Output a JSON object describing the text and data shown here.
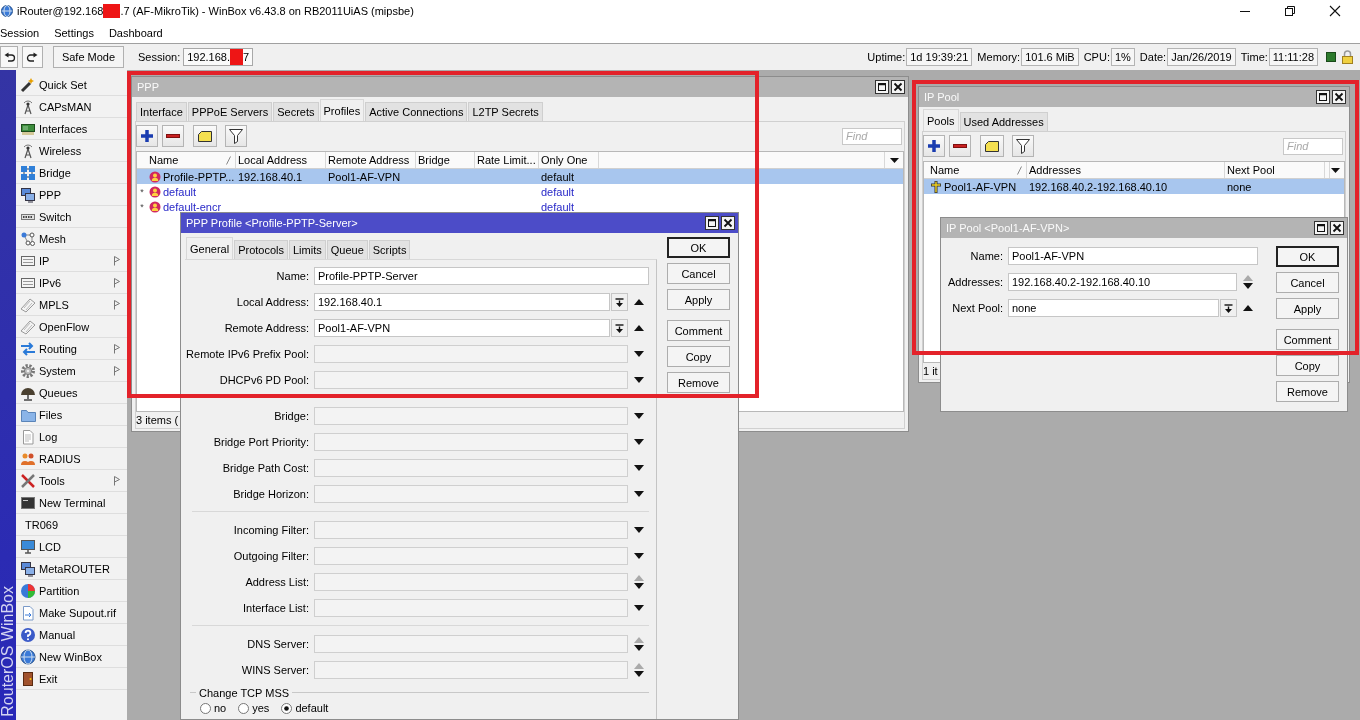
{
  "window": {
    "title": [
      {
        "kind": "text",
        "text": "iRouter@192.168"
      },
      {
        "kind": "redaction"
      },
      {
        "kind": "text",
        "text": ".7 (AF-MikroTik) - WinBox v6.43.8 on RB2011UiAS (mipsbe)"
      }
    ]
  },
  "menu": [
    {
      "label": "Session"
    },
    {
      "label": "Settings"
    },
    {
      "label": "Dashboard"
    }
  ],
  "toolbar": {
    "safe_mode": "Safe Mode",
    "session_label": "Session:",
    "session_value": [
      {
        "kind": "text",
        "text": "192.168."
      },
      {
        "kind": "redaction"
      },
      {
        "kind": "text",
        "text": "7"
      }
    ],
    "stats": [
      {
        "label": "Uptime:",
        "value": "1d 19:39:21"
      },
      {
        "label": "Memory:",
        "value": "101.6 MiB"
      },
      {
        "label": "CPU:",
        "value": "1%"
      },
      {
        "label": "Date:",
        "value": "Jan/26/2019"
      },
      {
        "label": "Time:",
        "value": "11:11:28"
      }
    ]
  },
  "sidebar": {
    "brand": "RouterOS WinBox",
    "items": [
      {
        "label": "Quick Set",
        "submenu": false
      },
      {
        "label": "CAPsMAN",
        "submenu": false
      },
      {
        "label": "Interfaces",
        "submenu": false
      },
      {
        "label": "Wireless",
        "submenu": false
      },
      {
        "label": "Bridge",
        "submenu": false
      },
      {
        "label": "PPP",
        "submenu": false
      },
      {
        "label": "Switch",
        "submenu": false
      },
      {
        "label": "Mesh",
        "submenu": false
      },
      {
        "label": "IP",
        "submenu": true
      },
      {
        "label": "IPv6",
        "submenu": true
      },
      {
        "label": "MPLS",
        "submenu": true
      },
      {
        "label": "OpenFlow",
        "submenu": false
      },
      {
        "label": "Routing",
        "submenu": true
      },
      {
        "label": "System",
        "submenu": true
      },
      {
        "label": "Queues",
        "submenu": false
      },
      {
        "label": "Files",
        "submenu": false
      },
      {
        "label": "Log",
        "submenu": false
      },
      {
        "label": "RADIUS",
        "submenu": false
      },
      {
        "label": "Tools",
        "submenu": true
      },
      {
        "label": "New Terminal",
        "submenu": false
      },
      {
        "label": "TR069",
        "submenu": false
      },
      {
        "label": "LCD",
        "submenu": false
      },
      {
        "label": "MetaROUTER",
        "submenu": false
      },
      {
        "label": "Partition",
        "submenu": false
      },
      {
        "label": "Make Supout.rif",
        "submenu": false
      },
      {
        "label": "Manual",
        "submenu": false
      },
      {
        "label": "New WinBox",
        "submenu": false
      },
      {
        "label": "Exit",
        "submenu": false
      }
    ]
  },
  "ppp_window": {
    "title": "PPP",
    "active": false,
    "tabs": [
      {
        "label": "Interface",
        "selected": false
      },
      {
        "label": "PPPoE Servers",
        "selected": false
      },
      {
        "label": "Secrets",
        "selected": false
      },
      {
        "label": "Profiles",
        "selected": true
      },
      {
        "label": "Active Connections",
        "selected": false
      },
      {
        "label": "L2TP Secrets",
        "selected": false
      }
    ],
    "find": {
      "placeholder": "Find"
    },
    "table": {
      "columns": [
        {
          "label": "Name",
          "sorted": true
        },
        {
          "label": "Local Address",
          "sorted": false
        },
        {
          "label": "Remote Address",
          "sorted": false
        },
        {
          "label": "Bridge",
          "sorted": false
        },
        {
          "label": "Rate Limit...",
          "sorted": false
        },
        {
          "label": "Only One",
          "sorted": false
        }
      ],
      "rows": [
        {
          "selected": true,
          "builtin": false,
          "cells": [
            "Profile-PPTP...",
            "192.168.40.1",
            "Pool1-AF-VPN",
            null,
            null,
            "default"
          ]
        },
        {
          "flag": "*",
          "selected": false,
          "builtin": true,
          "cells": [
            "default",
            null,
            null,
            null,
            null,
            "default"
          ]
        },
        {
          "flag": "*",
          "selected": false,
          "builtin": true,
          "cells": [
            "default-encr",
            null,
            null,
            null,
            null,
            "default"
          ]
        }
      ]
    },
    "status": "3 items ("
  },
  "ppp_profile_dialog": {
    "title": "PPP Profile <Profile-PPTP-Server>",
    "active": true,
    "tabs": [
      {
        "label": "General",
        "selected": true
      },
      {
        "label": "Protocols",
        "selected": false
      },
      {
        "label": "Limits",
        "selected": false
      },
      {
        "label": "Queue",
        "selected": false
      },
      {
        "label": "Scripts",
        "selected": false
      }
    ],
    "field_groups": [
      [
        {
          "kind": "text",
          "label": "Name:",
          "value": "Profile-PPTP-Server"
        },
        {
          "kind": "select",
          "label": "Local Address:",
          "value": "192.168.40.1"
        },
        {
          "kind": "select",
          "label": "Remote Address:",
          "value": "Pool1-AF-VPN"
        },
        {
          "kind": "optional",
          "label": "Remote IPv6 Prefix Pool:"
        },
        {
          "kind": "optional",
          "label": "DHCPv6 PD Pool:"
        }
      ],
      [
        {
          "kind": "optional",
          "label": "Bridge:"
        },
        {
          "kind": "optional",
          "label": "Bridge Port Priority:"
        },
        {
          "kind": "optional",
          "label": "Bridge Path Cost:"
        },
        {
          "kind": "optional",
          "label": "Bridge Horizon:"
        }
      ],
      [
        {
          "kind": "optional",
          "label": "Incoming Filter:"
        },
        {
          "kind": "optional",
          "label": "Outgoing Filter:"
        },
        {
          "kind": "multi",
          "label": "Address List:"
        },
        {
          "kind": "optional",
          "label": "Interface List:"
        }
      ],
      [
        {
          "kind": "multi",
          "label": "DNS Server:"
        },
        {
          "kind": "multi",
          "label": "WINS Server:"
        }
      ]
    ],
    "tcp_mss": {
      "legend": "Change TCP MSS",
      "options": [
        {
          "label": "no",
          "selected": false
        },
        {
          "label": "yes",
          "selected": false
        },
        {
          "label": "default",
          "selected": true
        }
      ]
    },
    "buttons": [
      {
        "label": "OK",
        "default": true
      },
      {
        "label": "Cancel",
        "default": false
      },
      {
        "label": "Apply",
        "default": false
      },
      {
        "label": "Comment",
        "default": false
      },
      {
        "label": "Copy",
        "default": false
      },
      {
        "label": "Remove",
        "default": false
      }
    ]
  },
  "ip_pool_window": {
    "title": "IP Pool",
    "active": false,
    "tabs": [
      {
        "label": "Pools",
        "selected": true
      },
      {
        "label": "Used Addresses",
        "selected": false
      }
    ],
    "find": {
      "placeholder": "Find"
    },
    "table": {
      "columns": [
        {
          "label": "Name",
          "sorted": true
        },
        {
          "label": "Addresses",
          "sorted": false
        },
        {
          "label": "Next Pool",
          "sorted": false
        }
      ],
      "rows": [
        {
          "selected": true,
          "builtin": false,
          "cells": [
            "Pool1-AF-VPN",
            "192.168.40.2-192.168.40.10",
            "none"
          ]
        }
      ]
    },
    "status": "1 it"
  },
  "ip_pool_dialog": {
    "title": "IP Pool <Pool1-AF-VPN>",
    "active": false,
    "field_groups": [
      [
        {
          "kind": "text",
          "label": "Name:",
          "value": "Pool1-AF-VPN"
        },
        {
          "kind": "multi",
          "label": "Addresses:",
          "value": "192.168.40.2-192.168.40.10"
        },
        {
          "kind": "select",
          "label": "Next Pool:",
          "value": "none"
        }
      ]
    ],
    "buttons": [
      {
        "label": "OK",
        "default": true
      },
      {
        "label": "Cancel",
        "default": false
      },
      {
        "label": "Apply",
        "default": false
      },
      {
        "label": "Comment",
        "default": false
      },
      {
        "label": "Copy",
        "default": false
      },
      {
        "label": "Remove",
        "default": false
      }
    ]
  },
  "annotations": [
    {
      "kind": "frame"
    },
    {
      "kind": "frame"
    }
  ]
}
